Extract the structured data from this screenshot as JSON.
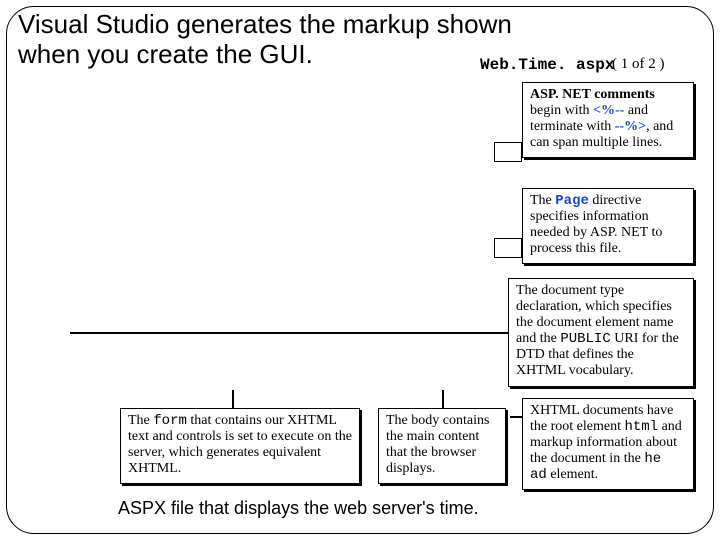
{
  "heading": "Visual Studio generates the markup shown when you create the GUI.",
  "filename": "Web.Time. aspx",
  "page_indicator": "( 1 of 2 )",
  "caption": "ASPX file that displays the web server's time.",
  "callouts": {
    "comments": {
      "p1_b": "ASP. NET comments",
      "p2a": "begin with ",
      "p2_code1": "<%--",
      "p2b": " and terminate with ",
      "p2_code2": "--%>",
      "p2c": ", and can span multiple lines."
    },
    "page": {
      "p1a": "The ",
      "p1_blue": "Page",
      "p1b": " directive specifies information needed by ASP. NET to process this file."
    },
    "doctype": {
      "p1a": "The document type declaration, which specifies the document element name and the ",
      "p1_mono": "PUBLIC",
      "p1b": " URI for the DTD that defines the XHTML vocabulary."
    },
    "xhtml": {
      "p1a": "XHTML documents have the root element ",
      "p1_mono1": "html",
      "p1b": " and markup information about the document in the ",
      "p1_mono2": "he ad",
      "p1c": " element."
    },
    "bodycall": {
      "p1": "The body contains the main content that the browser displays."
    },
    "form": {
      "p1a": "The ",
      "p1_mono": "form",
      "p1b": " that contains our XHTML text and controls is set to execute on the server, which generates equivalent XHTML."
    }
  }
}
